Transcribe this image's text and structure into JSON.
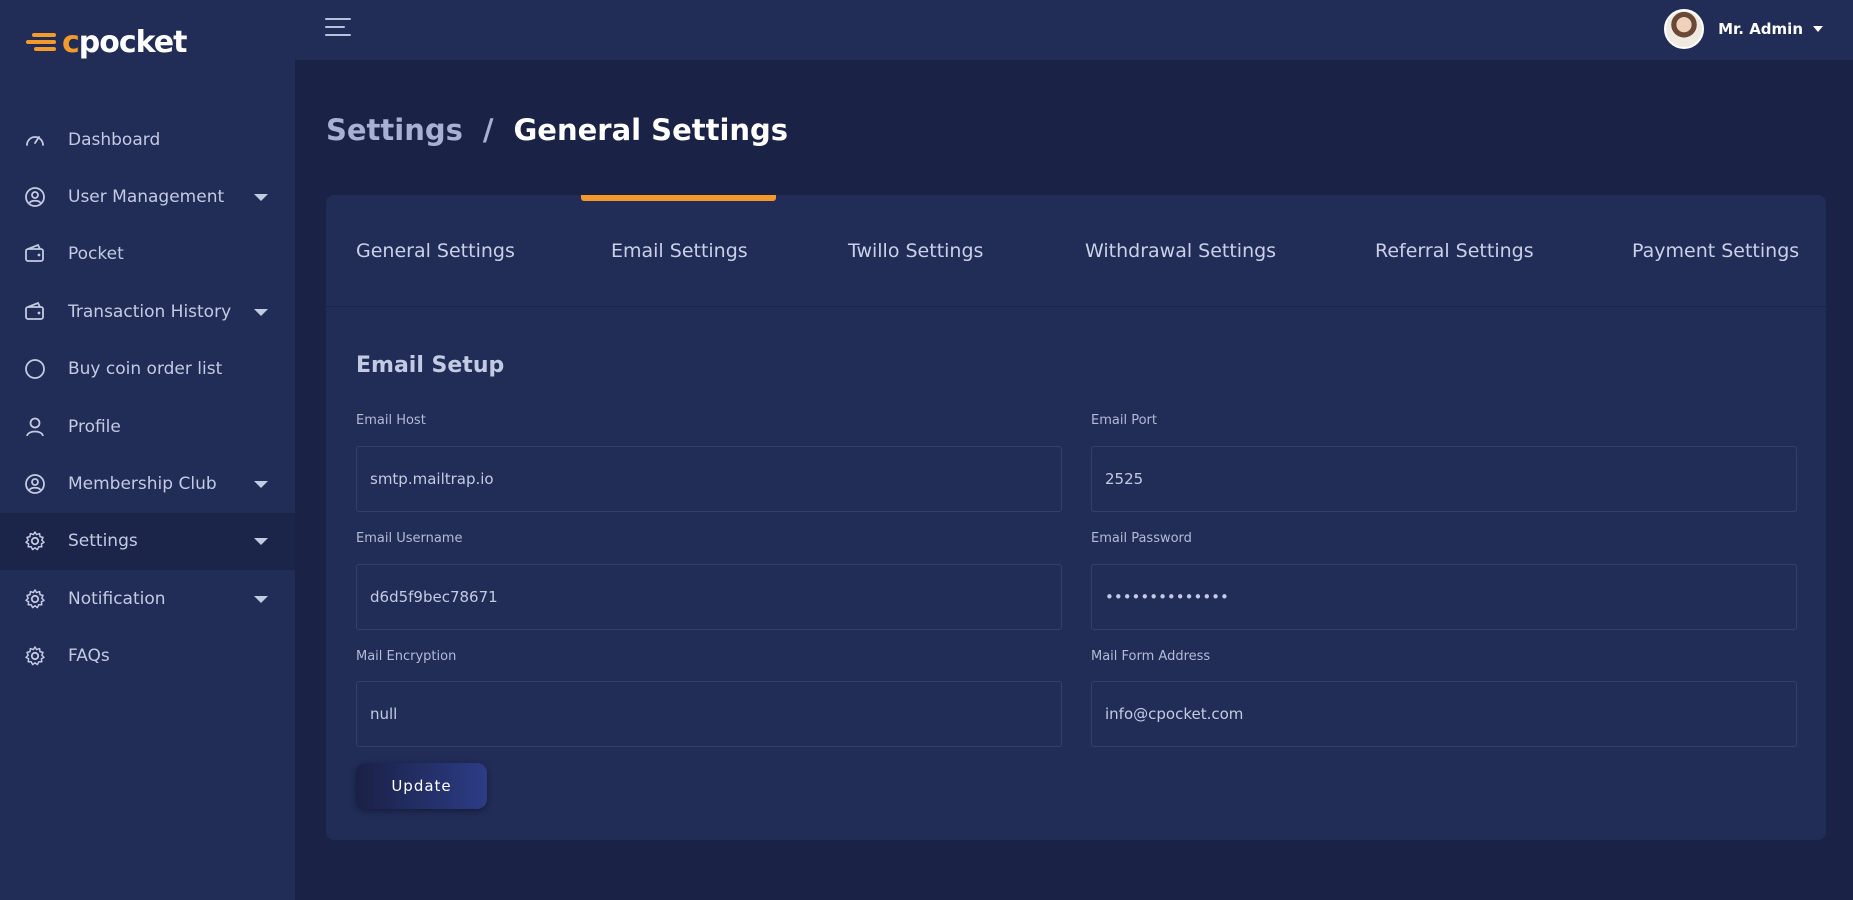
{
  "brand": {
    "logo_text": "cpocket",
    "logo_accent": "#f39a2b"
  },
  "sidebar": {
    "items": [
      {
        "label": "Dashboard",
        "icon": "dashboard-gauge-icon"
      },
      {
        "label": "User Management",
        "icon": "user-circle-icon",
        "has_submenu": true
      },
      {
        "label": "Pocket",
        "icon": "wallet-icon"
      },
      {
        "label": "Transaction History",
        "icon": "wallet-icon",
        "has_submenu": true
      },
      {
        "label": "Buy coin order list",
        "icon": "circle-icon"
      },
      {
        "label": "Profile",
        "icon": "user-icon"
      },
      {
        "label": "Membership Club",
        "icon": "user-circle-icon",
        "has_submenu": true
      },
      {
        "label": "Settings",
        "icon": "gear-icon",
        "has_submenu": true,
        "active": true
      },
      {
        "label": "Notification",
        "icon": "gear-icon",
        "has_submenu": true
      },
      {
        "label": "FAQs",
        "icon": "gear-icon"
      }
    ]
  },
  "topbar": {
    "menu_icon": "hamburger-icon",
    "user_name": "Mr. Admin"
  },
  "breadcrumb": {
    "parent": "Settings",
    "separator": "/",
    "current": "General Settings"
  },
  "tabs": [
    {
      "label": "General Settings"
    },
    {
      "label": "Email Settings",
      "active": true
    },
    {
      "label": "Twillo Settings"
    },
    {
      "label": "Withdrawal Settings"
    },
    {
      "label": "Referral Settings"
    },
    {
      "label": "Payment Settings"
    }
  ],
  "form": {
    "title": "Email Setup",
    "fields": {
      "email_host": {
        "label": "Email Host",
        "value": "smtp.mailtrap.io"
      },
      "email_port": {
        "label": "Email Port",
        "value": "2525"
      },
      "email_username": {
        "label": "Email Username",
        "value": "d6d5f9bec78671"
      },
      "email_password": {
        "label": "Email Password",
        "value": "••••••••••••••"
      },
      "mail_encryption": {
        "label": "Mail Encryption",
        "value": "null"
      },
      "mail_from_address": {
        "label": "Mail Form Address",
        "value": "info@cpocket.com"
      }
    },
    "submit_label": "Update"
  }
}
